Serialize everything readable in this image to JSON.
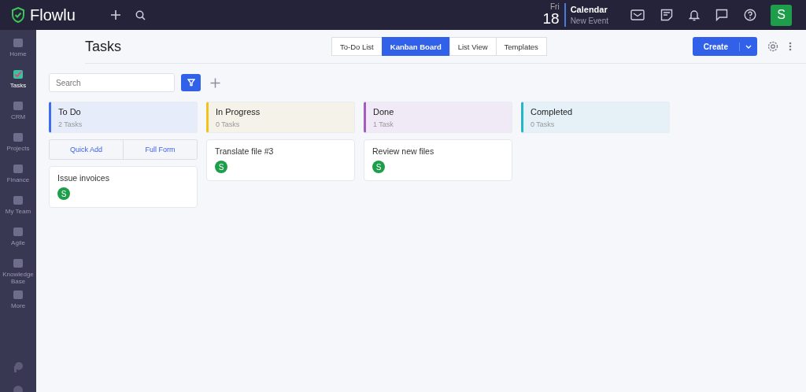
{
  "brand": {
    "name": "Flowlu"
  },
  "header": {
    "calendar": {
      "weekday": "Fri",
      "day": "18",
      "title": "Calendar",
      "subtitle": "New Event"
    },
    "avatar": "S"
  },
  "sidebar": {
    "items": [
      {
        "label": "Home",
        "selected": false
      },
      {
        "label": "Tasks",
        "selected": true
      },
      {
        "label": "CRM",
        "selected": false
      },
      {
        "label": "Projects",
        "selected": false
      },
      {
        "label": "Finance",
        "selected": false
      },
      {
        "label": "My Team",
        "selected": false
      },
      {
        "label": "Agile",
        "selected": false
      },
      {
        "label": "Knowledge Base",
        "selected": false
      },
      {
        "label": "More",
        "selected": false
      }
    ]
  },
  "page": {
    "title": "Tasks"
  },
  "view_tabs": [
    {
      "label": "To-Do List",
      "selected": false
    },
    {
      "label": "Kanban Board",
      "selected": true
    },
    {
      "label": "List View",
      "selected": false
    },
    {
      "label": "Templates",
      "selected": false
    }
  ],
  "create_button": "Create",
  "search": {
    "placeholder": "Search"
  },
  "columns": [
    {
      "name": "To Do",
      "count": "2 Tasks",
      "color": "#3b6ef0",
      "actions": [
        "Quick Add",
        "Full Form"
      ],
      "cards": [
        {
          "title": "Issue invoices",
          "avatar": "S"
        }
      ]
    },
    {
      "name": "In Progress",
      "count": "0 Tasks",
      "color": "#f2c31c",
      "cards": [
        {
          "title": "Translate file #3",
          "avatar": "S"
        }
      ]
    },
    {
      "name": "Done",
      "count": "1 Task",
      "color": "#a35cc4",
      "cards": [
        {
          "title": "Review new files",
          "avatar": "S"
        }
      ]
    },
    {
      "name": "Completed",
      "count": "0 Tasks",
      "color": "#22b8c8"
    }
  ]
}
